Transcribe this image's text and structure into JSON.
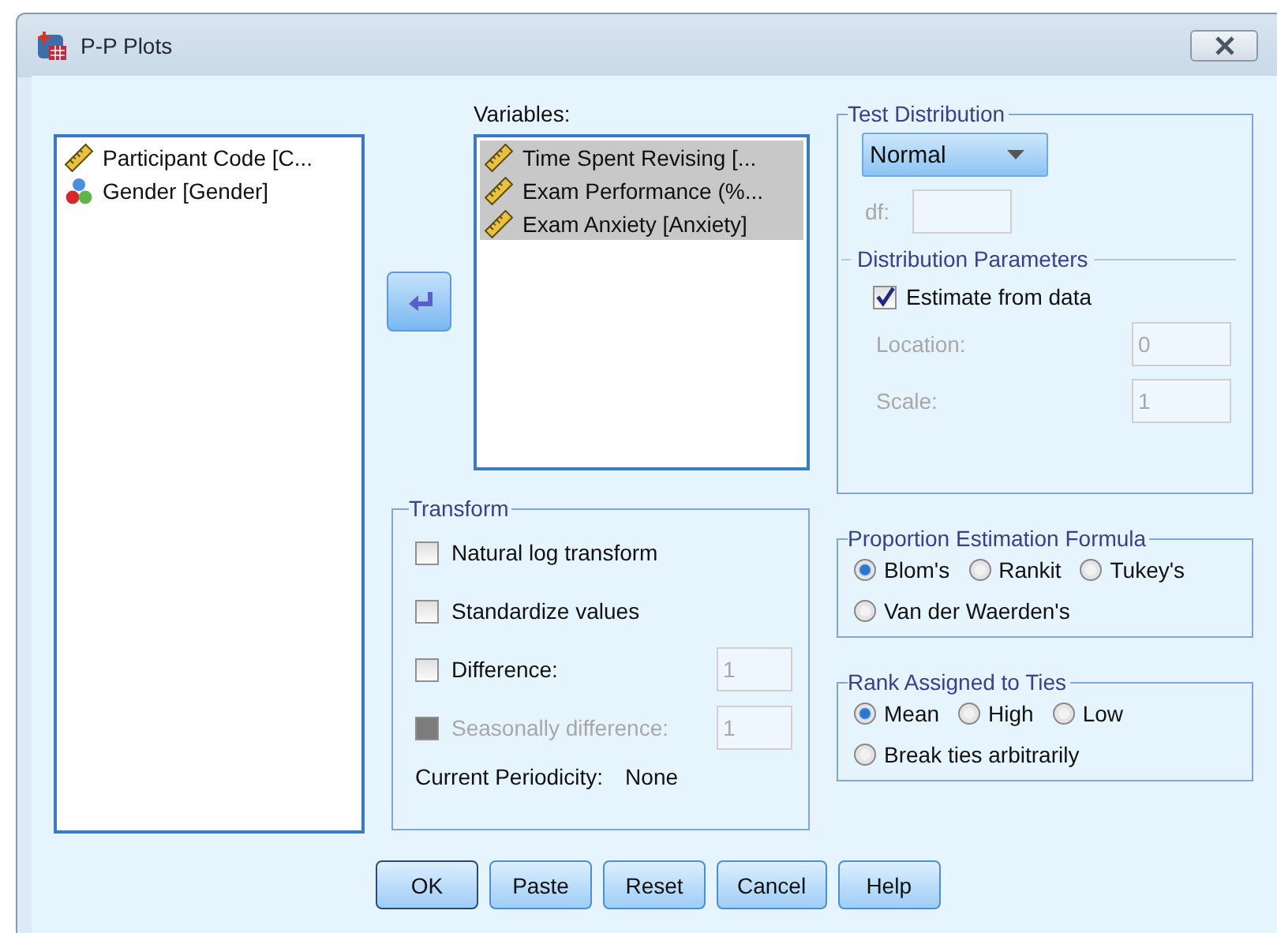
{
  "window": {
    "title": "P-P Plots"
  },
  "source_list": {
    "items": [
      {
        "label": "Participant Code [C...",
        "kind": "scale",
        "selected": false
      },
      {
        "label": "Gender [Gender]",
        "kind": "nominal",
        "selected": false
      }
    ]
  },
  "variables": {
    "label": "Variables:",
    "items": [
      {
        "label": "Time Spent Revising [...",
        "kind": "scale",
        "selected": true
      },
      {
        "label": "Exam Performance (%...",
        "kind": "scale",
        "selected": true
      },
      {
        "label": "Exam Anxiety [Anxiety]",
        "kind": "scale",
        "selected": true
      }
    ]
  },
  "test_distribution": {
    "title": "Test Distribution",
    "distribution": "Normal",
    "df": {
      "label": "df:",
      "disabled": true
    },
    "parameters": {
      "title": "Distribution Parameters",
      "estimate": {
        "label": "Estimate from data",
        "checked": true
      },
      "fields": [
        {
          "label": "Location:",
          "value": "0",
          "disabled": true
        },
        {
          "label": "Scale:",
          "value": "1",
          "disabled": true
        }
      ]
    }
  },
  "transform": {
    "title": "Transform",
    "options": [
      {
        "label": "Natural log transform",
        "checked": false,
        "disabled": false
      },
      {
        "label": "Standardize values",
        "checked": false,
        "disabled": false
      },
      {
        "label": "Difference:",
        "checked": false,
        "disabled": false,
        "value": "1"
      },
      {
        "label": "Seasonally difference:",
        "checked": false,
        "disabled": true,
        "value": "1"
      }
    ],
    "periodicity_label": "Current Periodicity:",
    "periodicity_value": "None"
  },
  "proportion_formula": {
    "title": "Proportion Estimation Formula",
    "options": [
      {
        "label": "Blom's",
        "selected": true
      },
      {
        "label": "Rankit",
        "selected": false
      },
      {
        "label": "Tukey's",
        "selected": false
      },
      {
        "label": "Van der Waerden's",
        "selected": false
      }
    ]
  },
  "rank_ties": {
    "title": "Rank Assigned to Ties",
    "options": [
      {
        "label": "Mean",
        "selected": true
      },
      {
        "label": "High",
        "selected": false
      },
      {
        "label": "Low",
        "selected": false
      },
      {
        "label": "Break ties arbitrarily",
        "selected": false
      }
    ]
  },
  "buttons": [
    {
      "label": "OK",
      "default": true
    },
    {
      "label": "Paste",
      "default": false
    },
    {
      "label": "Reset",
      "default": false
    },
    {
      "label": "Cancel",
      "default": false
    },
    {
      "label": "Help",
      "default": false
    }
  ]
}
